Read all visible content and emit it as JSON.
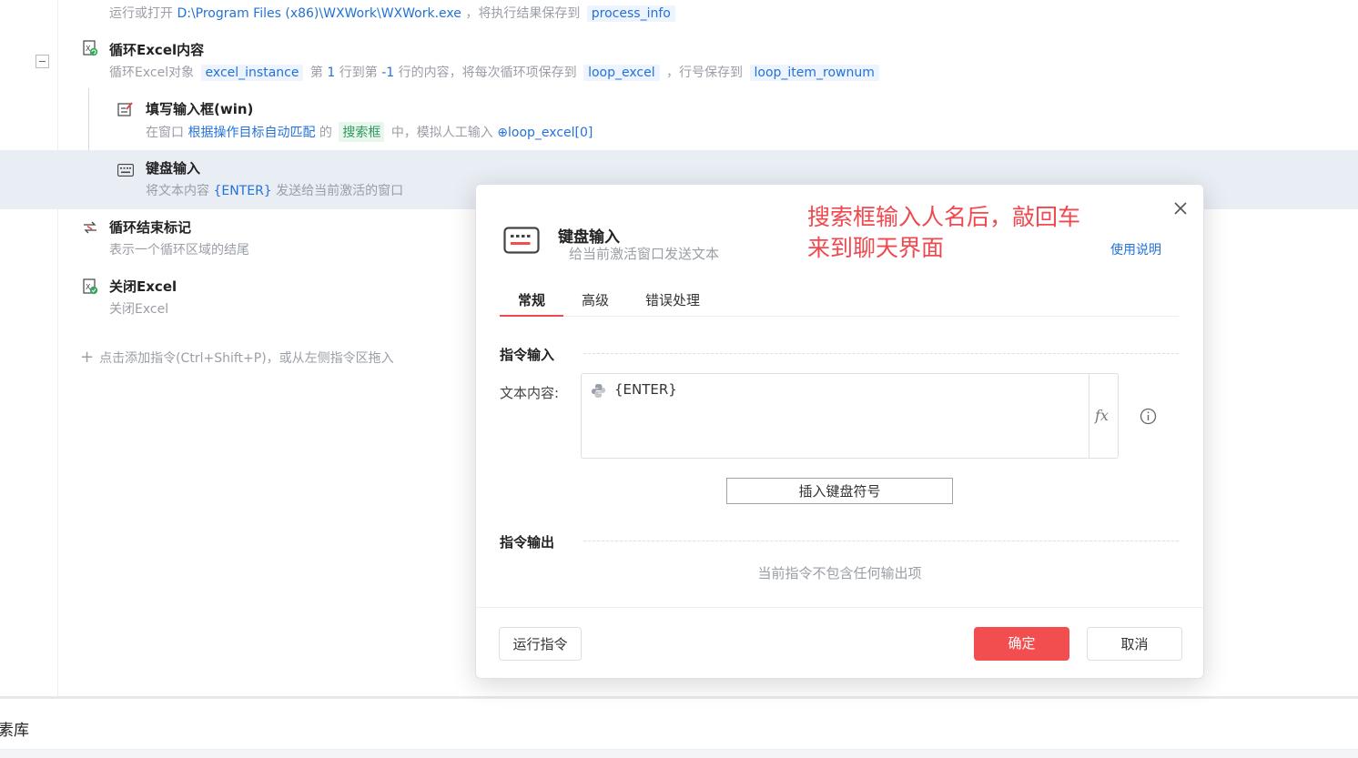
{
  "workflow": {
    "run_app": {
      "desc_prefix": "运行或打开",
      "path": "D:\\Program Files (x86)\\WXWork\\WXWork.exe",
      "desc_mid": "，将执行结果保存到",
      "output_var": "process_info"
    },
    "loop_excel": {
      "title": "循环Excel内容",
      "desc_prefix": "循环Excel对象",
      "excel_var": "excel_instance",
      "desc_mid1": "第",
      "start_row": "1",
      "desc_mid2": "行到第",
      "end_row": "-1",
      "desc_mid3": "行的内容，将每次循环项保存到",
      "loop_var": "loop_excel",
      "desc_mid4": "，行号保存到",
      "rownum_var": "loop_item_rownum"
    },
    "fill_input": {
      "title": "填写输入框(win)",
      "desc_prefix": "在窗口",
      "window_target": "根据操作目标自动匹配",
      "desc_mid1": "的",
      "element": "搜索框",
      "desc_mid2": "中，模拟人工输入",
      "input_var": "loop_excel[0]"
    },
    "keyboard_input": {
      "title": "键盘输入",
      "desc_prefix": "将文本内容",
      "text_value": "{ENTER}",
      "desc_suffix": "发送给当前激活的窗口"
    },
    "loop_end": {
      "title": "循环结束标记",
      "desc": "表示一个循环区域的结尾"
    },
    "close_excel": {
      "title": "关闭Excel",
      "desc": "关闭Excel"
    },
    "add_hint": "点击添加指令(Ctrl+Shift+P)，或从左侧指令区拖入"
  },
  "bottom_panel": {
    "label": "素库"
  },
  "dialog": {
    "title": "键盘输入",
    "subtitle": "给当前激活窗口发送文本",
    "annotation_line1": "搜索框输入人名后，敲回车",
    "annotation_line2": "来到聊天界面",
    "help_link": "使用说明",
    "tabs": [
      "常规",
      "高级",
      "错误处理"
    ],
    "active_tab_index": 0,
    "input_section": "指令输入",
    "text_label": "文本内容:",
    "text_value": "{ENTER}",
    "fx_label": "fx",
    "insert_button": "插入键盘符号",
    "output_section": "指令输出",
    "no_output": "当前指令不包含任何输出项",
    "run_button": "运行指令",
    "ok_button": "确定",
    "cancel_button": "取消"
  },
  "colors": {
    "accent_red": "#f24d4f",
    "link_blue": "#2372d8",
    "annotation_red": "#f0484e",
    "highlight_row": "#e9edf4"
  },
  "icons": {
    "run_app": "app-run-icon",
    "loop_excel": "excel-loop-icon",
    "fill_input": "edit-input-icon",
    "keyboard": "keyboard-icon",
    "loop_end": "loop-end-icon",
    "close_excel": "excel-close-icon",
    "python": "python-icon",
    "info": "info-icon",
    "close": "close-icon"
  }
}
